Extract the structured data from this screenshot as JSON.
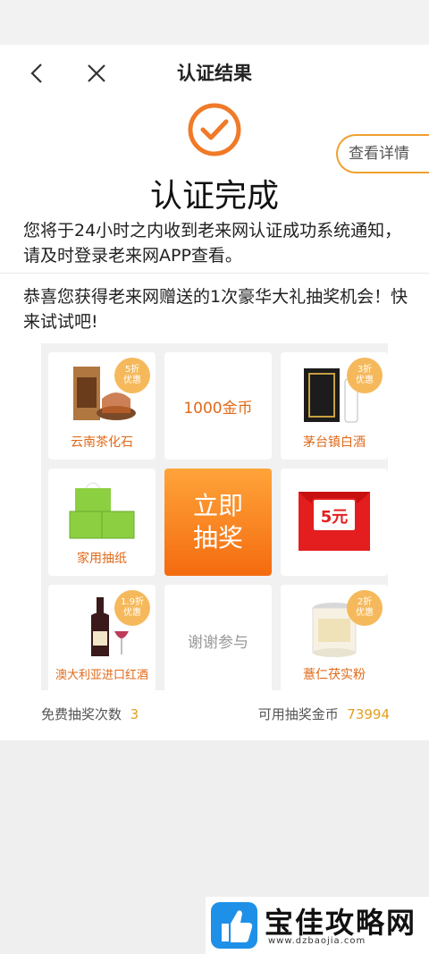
{
  "nav": {
    "title": "认证结果"
  },
  "result": {
    "detail_button": "查看详情",
    "title": "认证完成",
    "notice": "您将于24小时之内收到老来网认证成功系统通知，请及时登录老来网APP查看。"
  },
  "lottery": {
    "congrats": "恭喜您获得老来网赠送的1次豪华大礼抽奖机会！快来试试吧!",
    "draw_button_line1": "立即",
    "draw_button_line2": "抽奖",
    "prizes": [
      {
        "label": "云南茶化石",
        "badge_line1": "5折",
        "badge_line2": "优惠"
      },
      {
        "label": "1000金币"
      },
      {
        "label": "茅台镇白酒",
        "badge_line1": "3折",
        "badge_line2": "优惠"
      },
      {
        "label": "家用抽纸"
      },
      {
        "label": "5元"
      },
      {
        "label": "澳大利亚进口红酒",
        "badge_line1": "1.9折",
        "badge_line2": "优惠"
      },
      {
        "label": "谢谢参与"
      },
      {
        "label": "薏仁茯实粉",
        "badge_line1": "2折",
        "badge_line2": "优惠"
      }
    ],
    "free_draws_label": "免费抽奖次数",
    "free_draws_value": "3",
    "coins_label": "可用抽奖金币",
    "coins_value": "73994"
  },
  "watermark": {
    "title": "宝佳攻略网",
    "url": "www.dzbaojia.com"
  },
  "colors": {
    "accent": "#f46b0f",
    "badge": "#f5b95c",
    "border_accent": "#f0a030"
  }
}
